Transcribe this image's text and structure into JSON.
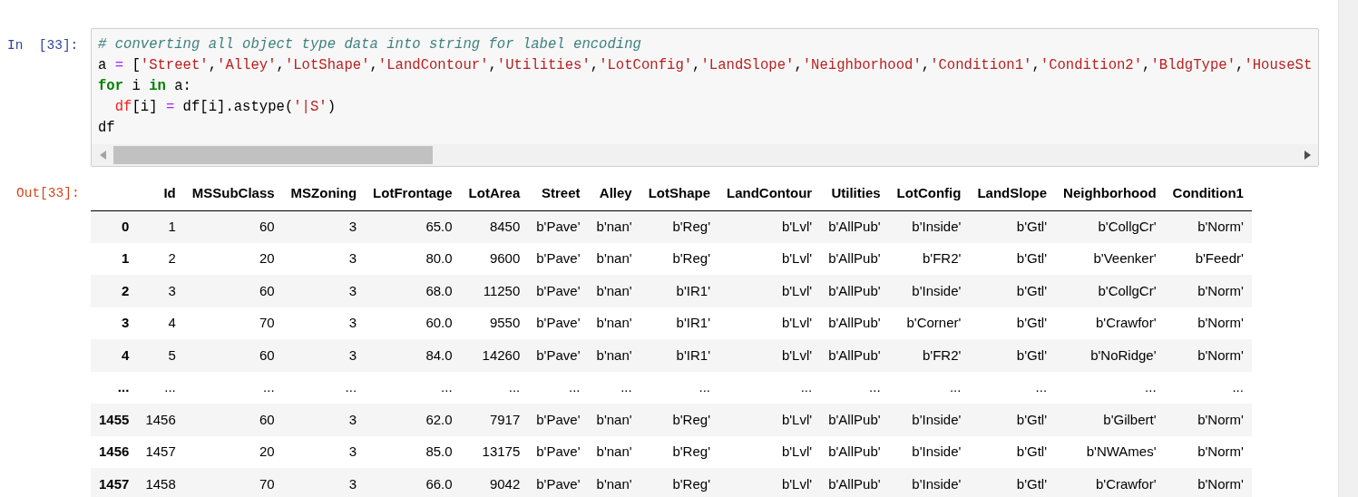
{
  "input_cell": {
    "prompt": "In  [33]:",
    "lines": [
      [
        {
          "kind": "comment",
          "text": "# converting all object type data into string for label encoding"
        }
      ],
      [
        {
          "kind": "plain",
          "text": "a "
        },
        {
          "kind": "op",
          "text": "="
        },
        {
          "kind": "plain",
          "text": " ["
        },
        {
          "kind": "string",
          "text": "'Street'"
        },
        {
          "kind": "plain",
          "text": ","
        },
        {
          "kind": "string",
          "text": "'Alley'"
        },
        {
          "kind": "plain",
          "text": ","
        },
        {
          "kind": "string",
          "text": "'LotShape'"
        },
        {
          "kind": "plain",
          "text": ","
        },
        {
          "kind": "string",
          "text": "'LandContour'"
        },
        {
          "kind": "plain",
          "text": ","
        },
        {
          "kind": "string",
          "text": "'Utilities'"
        },
        {
          "kind": "plain",
          "text": ","
        },
        {
          "kind": "string",
          "text": "'LotConfig'"
        },
        {
          "kind": "plain",
          "text": ","
        },
        {
          "kind": "string",
          "text": "'LandSlope'"
        },
        {
          "kind": "plain",
          "text": ","
        },
        {
          "kind": "string",
          "text": "'Neighborhood'"
        },
        {
          "kind": "plain",
          "text": ","
        },
        {
          "kind": "string",
          "text": "'Condition1'"
        },
        {
          "kind": "plain",
          "text": ","
        },
        {
          "kind": "string",
          "text": "'Condition2'"
        },
        {
          "kind": "plain",
          "text": ","
        },
        {
          "kind": "string",
          "text": "'BldgType'"
        },
        {
          "kind": "plain",
          "text": ","
        },
        {
          "kind": "string",
          "text": "'HouseSt"
        }
      ],
      [
        {
          "kind": "keyword",
          "text": "for"
        },
        {
          "kind": "plain",
          "text": " i "
        },
        {
          "kind": "keyword",
          "text": "in"
        },
        {
          "kind": "plain",
          "text": " a:"
        }
      ],
      [
        {
          "kind": "var",
          "text": "  df"
        },
        {
          "kind": "plain",
          "text": "[i] "
        },
        {
          "kind": "op",
          "text": "="
        },
        {
          "kind": "plain",
          "text": " df[i].astype("
        },
        {
          "kind": "string",
          "text": "'|S'"
        },
        {
          "kind": "plain",
          "text": ")"
        }
      ],
      [
        {
          "kind": "plain",
          "text": "df"
        }
      ]
    ]
  },
  "output_cell": {
    "prompt": "Out[33]:",
    "table": {
      "columns": [
        "Id",
        "MSSubClass",
        "MSZoning",
        "LotFrontage",
        "LotArea",
        "Street",
        "Alley",
        "LotShape",
        "LandContour",
        "Utilities",
        "LotConfig",
        "LandSlope",
        "Neighborhood",
        "Condition1"
      ],
      "rows": [
        {
          "index": "0",
          "cells": [
            "1",
            "60",
            "3",
            "65.0",
            "8450",
            "b'Pave'",
            "b'nan'",
            "b'Reg'",
            "b'Lvl'",
            "b'AllPub'",
            "b'Inside'",
            "b'Gtl'",
            "b'CollgCr'",
            "b'Norm'"
          ]
        },
        {
          "index": "1",
          "cells": [
            "2",
            "20",
            "3",
            "80.0",
            "9600",
            "b'Pave'",
            "b'nan'",
            "b'Reg'",
            "b'Lvl'",
            "b'AllPub'",
            "b'FR2'",
            "b'Gtl'",
            "b'Veenker'",
            "b'Feedr'"
          ]
        },
        {
          "index": "2",
          "cells": [
            "3",
            "60",
            "3",
            "68.0",
            "11250",
            "b'Pave'",
            "b'nan'",
            "b'IR1'",
            "b'Lvl'",
            "b'AllPub'",
            "b'Inside'",
            "b'Gtl'",
            "b'CollgCr'",
            "b'Norm'"
          ]
        },
        {
          "index": "3",
          "cells": [
            "4",
            "70",
            "3",
            "60.0",
            "9550",
            "b'Pave'",
            "b'nan'",
            "b'IR1'",
            "b'Lvl'",
            "b'AllPub'",
            "b'Corner'",
            "b'Gtl'",
            "b'Crawfor'",
            "b'Norm'"
          ]
        },
        {
          "index": "4",
          "cells": [
            "5",
            "60",
            "3",
            "84.0",
            "14260",
            "b'Pave'",
            "b'nan'",
            "b'IR1'",
            "b'Lvl'",
            "b'AllPub'",
            "b'FR2'",
            "b'Gtl'",
            "b'NoRidge'",
            "b'Norm'"
          ]
        },
        {
          "index": "...",
          "cells": [
            "...",
            "...",
            "...",
            "...",
            "...",
            "...",
            "...",
            "...",
            "...",
            "...",
            "...",
            "...",
            "...",
            "..."
          ]
        },
        {
          "index": "1455",
          "cells": [
            "1456",
            "60",
            "3",
            "62.0",
            "7917",
            "b'Pave'",
            "b'nan'",
            "b'Reg'",
            "b'Lvl'",
            "b'AllPub'",
            "b'Inside'",
            "b'Gtl'",
            "b'Gilbert'",
            "b'Norm'"
          ]
        },
        {
          "index": "1456",
          "cells": [
            "1457",
            "20",
            "3",
            "85.0",
            "13175",
            "b'Pave'",
            "b'nan'",
            "b'Reg'",
            "b'Lvl'",
            "b'AllPub'",
            "b'Inside'",
            "b'Gtl'",
            "b'NWAmes'",
            "b'Norm'"
          ]
        },
        {
          "index": "1457",
          "cells": [
            "1458",
            "70",
            "3",
            "66.0",
            "9042",
            "b'Pave'",
            "b'nan'",
            "b'Reg'",
            "b'Lvl'",
            "b'AllPub'",
            "b'Inside'",
            "b'Gtl'",
            "b'Crawfor'",
            "b'Norm'"
          ]
        }
      ]
    }
  }
}
